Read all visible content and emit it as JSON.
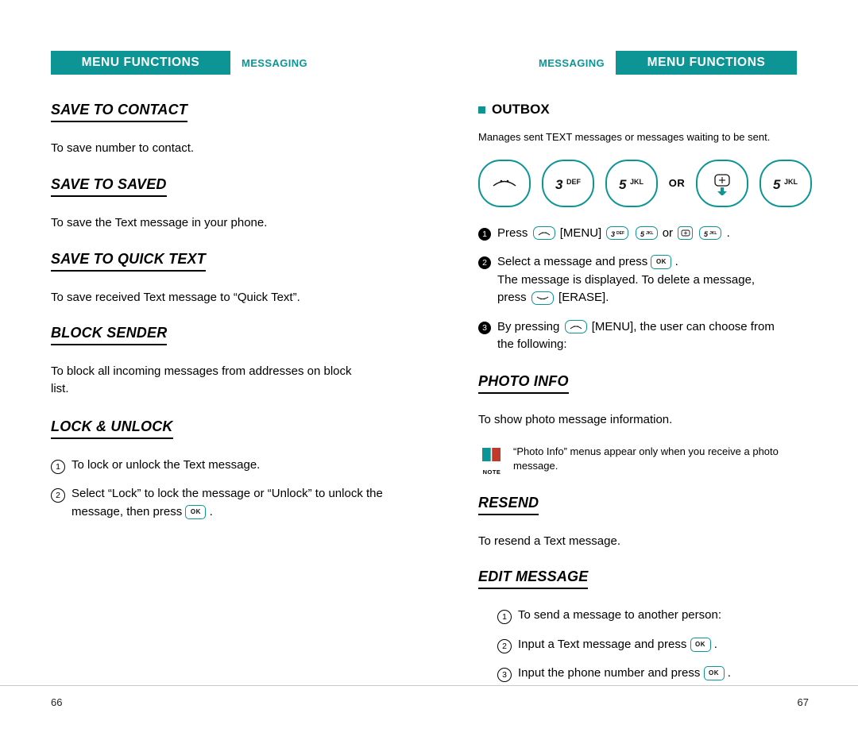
{
  "header": {
    "left_bar": "MENU FUNCTIONS",
    "left_sub": "MESSAGING",
    "right_bar": "MENU FUNCTIONS",
    "right_sub": "MESSAGING"
  },
  "left_page": {
    "sections": [
      {
        "title": "SAVE TO CONTACT",
        "body": "To save number to contact."
      },
      {
        "title": "SAVE TO SAVED",
        "body": "To save the Text message in your phone."
      },
      {
        "title": "SAVE TO QUICK TEXT",
        "body": "To save received Text message to “Quick Text”."
      },
      {
        "title": "BLOCK SENDER",
        "body": "To block all incoming messages from addresses on block list."
      }
    ],
    "lock_unlock": {
      "title": "LOCK & UNLOCK",
      "step1_num": "1",
      "step1": "To lock or unlock the Text message.",
      "step2_num": "2",
      "step2_a": "Select “Lock” to lock the message or “Unlock” to unlock the message, then press",
      "step2_key": "OK",
      "step2_b": "."
    },
    "page_number": "66"
  },
  "right_page": {
    "outbox": {
      "title": "OUTBOX",
      "intro": "Manages sent TEXT messages or messages waiting to be sent.",
      "keys": [
        {
          "name": "menu-key",
          "label": ""
        },
        {
          "name": "key-3-def",
          "label": "3",
          "sub": "DEF"
        },
        {
          "name": "key-5-jkl",
          "label": "5",
          "sub": "JKL"
        },
        {
          "name": "or-label",
          "label": "OR"
        },
        {
          "name": "navigation-key",
          "label": ""
        },
        {
          "name": "key-5-jkl-2",
          "label": "5",
          "sub": "JKL"
        }
      ],
      "or_text": "OR",
      "step1_num": "1",
      "step1_a": "Press",
      "step1_menu": "[MENU]",
      "step1_or": "or",
      "step1_end": ".",
      "step2_num": "2",
      "step2_a": "Select a message and press",
      "step2_ok": "OK",
      "step2_b": ".",
      "step2_line2": "The message is displayed. To delete a message,",
      "step2_line3_a": "press",
      "step2_line3_b": "[ERASE].",
      "step3_num": "3",
      "step3_a": "By pressing",
      "step3_menu": "[MENU], the user can choose from",
      "step3_line2": "the following:"
    },
    "photo_info": {
      "title": "PHOTO INFO",
      "body": "To show photo message information.",
      "note_label": "NOTE",
      "note_text": "“Photo Info” menus appear only when you receive a photo message."
    },
    "resend": {
      "title": "RESEND",
      "body": "To resend a Text message."
    },
    "edit_message": {
      "title": "EDIT MESSAGE",
      "step1_num": "1",
      "step1": "To send a message to another person:",
      "step2_num": "2",
      "step2_a": "Input a Text message and press",
      "step2_key": "OK",
      "step2_b": ".",
      "step3_num": "3",
      "step3_a": "Input the phone number and press",
      "step3_key": "OK",
      "step3_b": "."
    },
    "page_number": "67"
  },
  "colors": {
    "accent": "#0d9596",
    "text": "#000000"
  }
}
